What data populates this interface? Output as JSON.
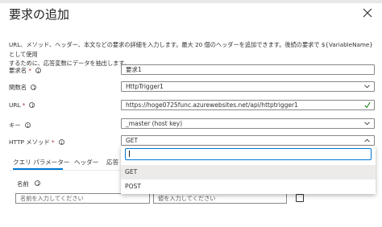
{
  "dialog": {
    "title": "要求の追加",
    "description_line1": "URL、メソッド、ヘッダー、本文などの要求の詳細を入力します。最大 20 個のヘッダーを追加できます。後続の要求で ${VariableName} として使用",
    "description_line2": "するために、応答変数にデータを抽出します。"
  },
  "fields": {
    "request_name": {
      "label": "要求名",
      "required": "*",
      "value": "要求1"
    },
    "function_name": {
      "label": "関数名",
      "value": "HttpTrigger1"
    },
    "url": {
      "label": "URL",
      "required": "*",
      "value": "https://hoge0725func.azurewebsites.net/api/httptrigger1"
    },
    "key": {
      "label": "キー",
      "value": "_master (host key)"
    },
    "http_method": {
      "label": "HTTP メソッド",
      "required": "*",
      "value": "GET"
    }
  },
  "tabs": [
    "クエリ パラメーター",
    "ヘッダー",
    "応答"
  ],
  "params": {
    "name_column": "名前",
    "name_placeholder": "名前を入力してください",
    "value_placeholder": "値を入力してください"
  },
  "method_dropdown": {
    "search_value": "",
    "options": [
      "GET",
      "POST"
    ],
    "selected": "GET"
  },
  "colors": {
    "accent": "#0078d4",
    "required": "#a4262c",
    "valid": "#107c10"
  }
}
